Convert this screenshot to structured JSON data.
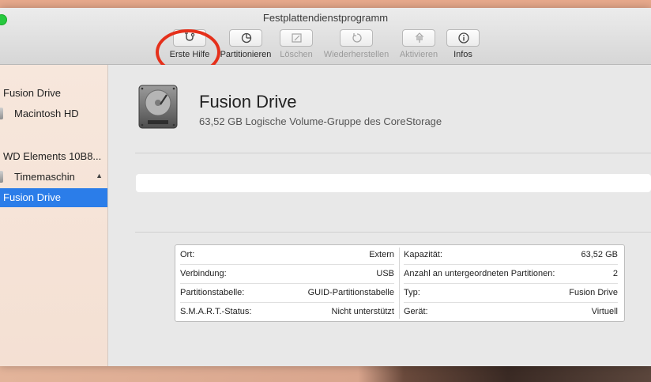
{
  "window": {
    "title": "Festplattendienstprogramm"
  },
  "toolbar": {
    "first_aid": "Erste Hilfe",
    "partition": "Partitionieren",
    "erase": "Löschen",
    "restore": "Wiederherstellen",
    "mount": "Aktivieren",
    "info": "Infos"
  },
  "sidebar": {
    "items": [
      {
        "label": "Fusion Drive"
      },
      {
        "label": "Macintosh HD"
      },
      {
        "label": "WD Elements 10B8..."
      },
      {
        "label": "Timemaschin"
      },
      {
        "label": "Fusion Drive"
      }
    ]
  },
  "main": {
    "drive_name": "Fusion Drive",
    "drive_desc": "63,52 GB Logische Volume-Gruppe des CoreStorage"
  },
  "info": {
    "left": [
      {
        "k": "Ort:",
        "v": "Extern"
      },
      {
        "k": "Verbindung:",
        "v": "USB"
      },
      {
        "k": "Partitionstabelle:",
        "v": "GUID-Partitionstabelle"
      },
      {
        "k": "S.M.A.R.T.-Status:",
        "v": "Nicht unterstützt"
      }
    ],
    "right": [
      {
        "k": "Kapazität:",
        "v": "63,52 GB"
      },
      {
        "k": "Anzahl an untergeordneten Partitionen:",
        "v": "2"
      },
      {
        "k": "Typ:",
        "v": "Fusion Drive"
      },
      {
        "k": "Gerät:",
        "v": "Virtuell"
      }
    ]
  },
  "colors": {
    "selection": "#2b7de9",
    "annotation_circle": "#e5301b"
  }
}
